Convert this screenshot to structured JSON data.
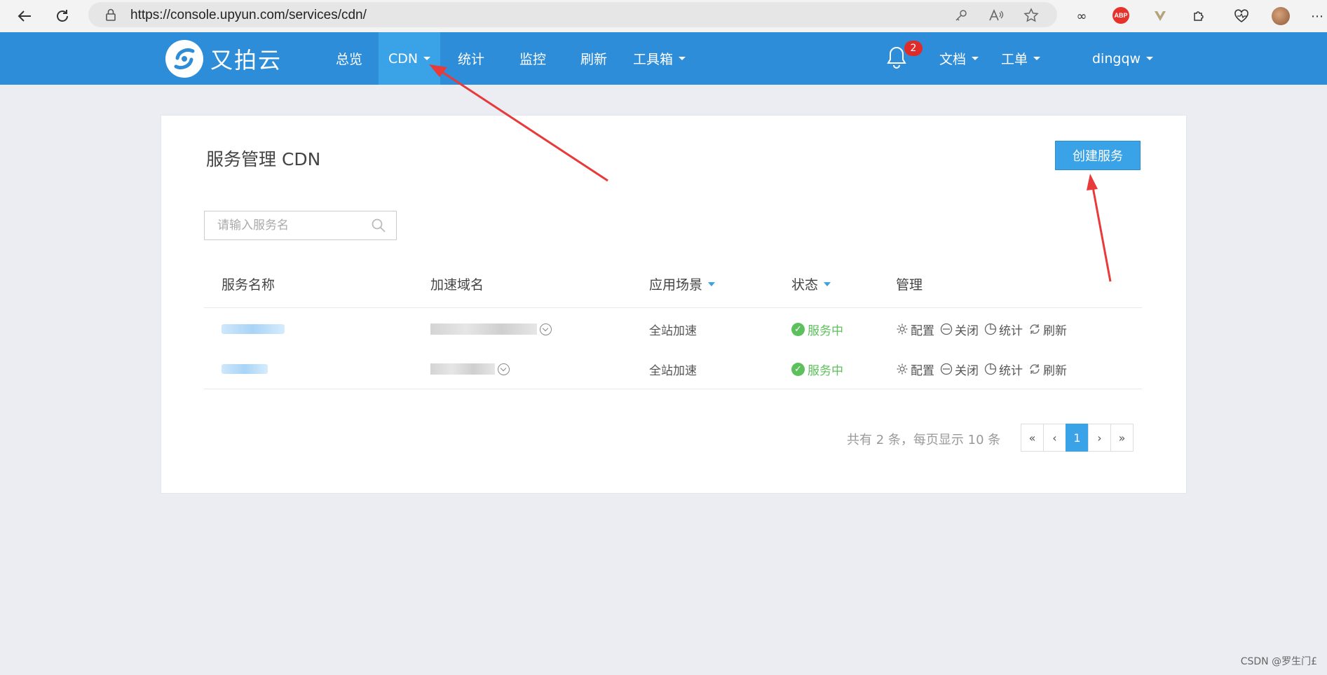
{
  "browser": {
    "url": "https://console.upyun.com/services/cdn/",
    "abp_label": "ABP"
  },
  "header": {
    "logo_text": "又拍云",
    "menu": [
      {
        "label": "总览",
        "dropdown": false
      },
      {
        "label": "CDN",
        "dropdown": true,
        "active": true
      },
      {
        "label": "统计",
        "dropdown": false
      },
      {
        "label": "监控",
        "dropdown": false
      },
      {
        "label": "刷新",
        "dropdown": false
      },
      {
        "label": "工具箱",
        "dropdown": true
      }
    ],
    "notification_count": "2",
    "docs_label": "文档",
    "ticket_label": "工单",
    "username": "dingqw"
  },
  "page": {
    "title": "服务管理 CDN",
    "create_button": "创建服务",
    "search_placeholder": "请输入服务名",
    "columns": [
      "服务名称",
      "加速域名",
      "应用场景",
      "状态",
      "管理"
    ],
    "rows": [
      {
        "scenario": "全站加速",
        "status": "服务中"
      },
      {
        "scenario": "全站加速",
        "status": "服务中"
      }
    ],
    "actions": [
      "配置",
      "关闭",
      "统计",
      "刷新"
    ],
    "pagination": {
      "info": "共有 2 条，每页显示 10 条",
      "first": "«",
      "prev": "‹",
      "current": "1",
      "next": "›",
      "last": "»"
    }
  },
  "watermark": "CSDN @罗生门£",
  "colors": {
    "header_bg": "#2e8dd8",
    "accent": "#3aa2e6",
    "status_ok": "#5cc05c",
    "annotation_arrow": "#e83a3a"
  }
}
